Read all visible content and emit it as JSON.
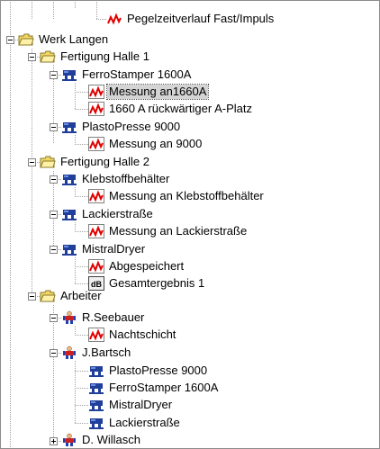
{
  "tree": {
    "nodes": [
      {
        "label": "Pegelzeitverlauf Fast/Impuls",
        "icon": "measurement-chart-icon"
      },
      {
        "label": "Werk Langen",
        "icon": "folder-open-icon"
      },
      {
        "label": "Fertigung Halle 1",
        "icon": "folder-open-icon"
      },
      {
        "label": "FerroStamper 1600A",
        "icon": "machine-icon"
      },
      {
        "label": "Messung an1660A",
        "icon": "measurement-chart-icon",
        "selected": true
      },
      {
        "label": "1660 A rückwärtiger A-Platz",
        "icon": "measurement-chart-icon"
      },
      {
        "label": "PlastoPresse 9000",
        "icon": "machine-icon"
      },
      {
        "label": "Messung an 9000",
        "icon": "measurement-chart-icon"
      },
      {
        "label": "Fertigung Halle 2",
        "icon": "folder-open-icon"
      },
      {
        "label": "Klebstoffbehälter",
        "icon": "machine-icon"
      },
      {
        "label": "Messung an Klebstoffbehälter",
        "icon": "measurement-chart-icon"
      },
      {
        "label": "Lackierstraße",
        "icon": "machine-icon"
      },
      {
        "label": "Messung an Lackierstraße",
        "icon": "measurement-chart-icon"
      },
      {
        "label": "MistralDryer",
        "icon": "machine-icon"
      },
      {
        "label": "Abgespeichert",
        "icon": "measurement-chart-icon"
      },
      {
        "label": "Gesamtergebnis 1",
        "icon": "db-result-icon",
        "icon_text": "dB"
      },
      {
        "label": "Arbeiter",
        "icon": "folder-open-icon"
      },
      {
        "label": "R.Seebauer",
        "icon": "worker-icon"
      },
      {
        "label": "Nachtschicht",
        "icon": "measurement-chart-icon"
      },
      {
        "label": "J.Bartsch",
        "icon": "worker-icon"
      },
      {
        "label": "PlastoPresse 9000",
        "icon": "machine-icon"
      },
      {
        "label": "FerroStamper 1600A",
        "icon": "machine-icon"
      },
      {
        "label": "MistralDryer",
        "icon": "machine-icon"
      },
      {
        "label": "Lackierstraße",
        "icon": "machine-icon"
      },
      {
        "label": "D. Willasch",
        "icon": "worker-icon"
      }
    ]
  },
  "colors": {
    "folder": "#f2d764",
    "machine": "#1f3f9a",
    "chart_red": "#e00000",
    "worker_red": "#cc2020",
    "worker_blue": "#2040b0",
    "selection": "#d4d4d4",
    "tree_lines": "#a0a0a0"
  }
}
